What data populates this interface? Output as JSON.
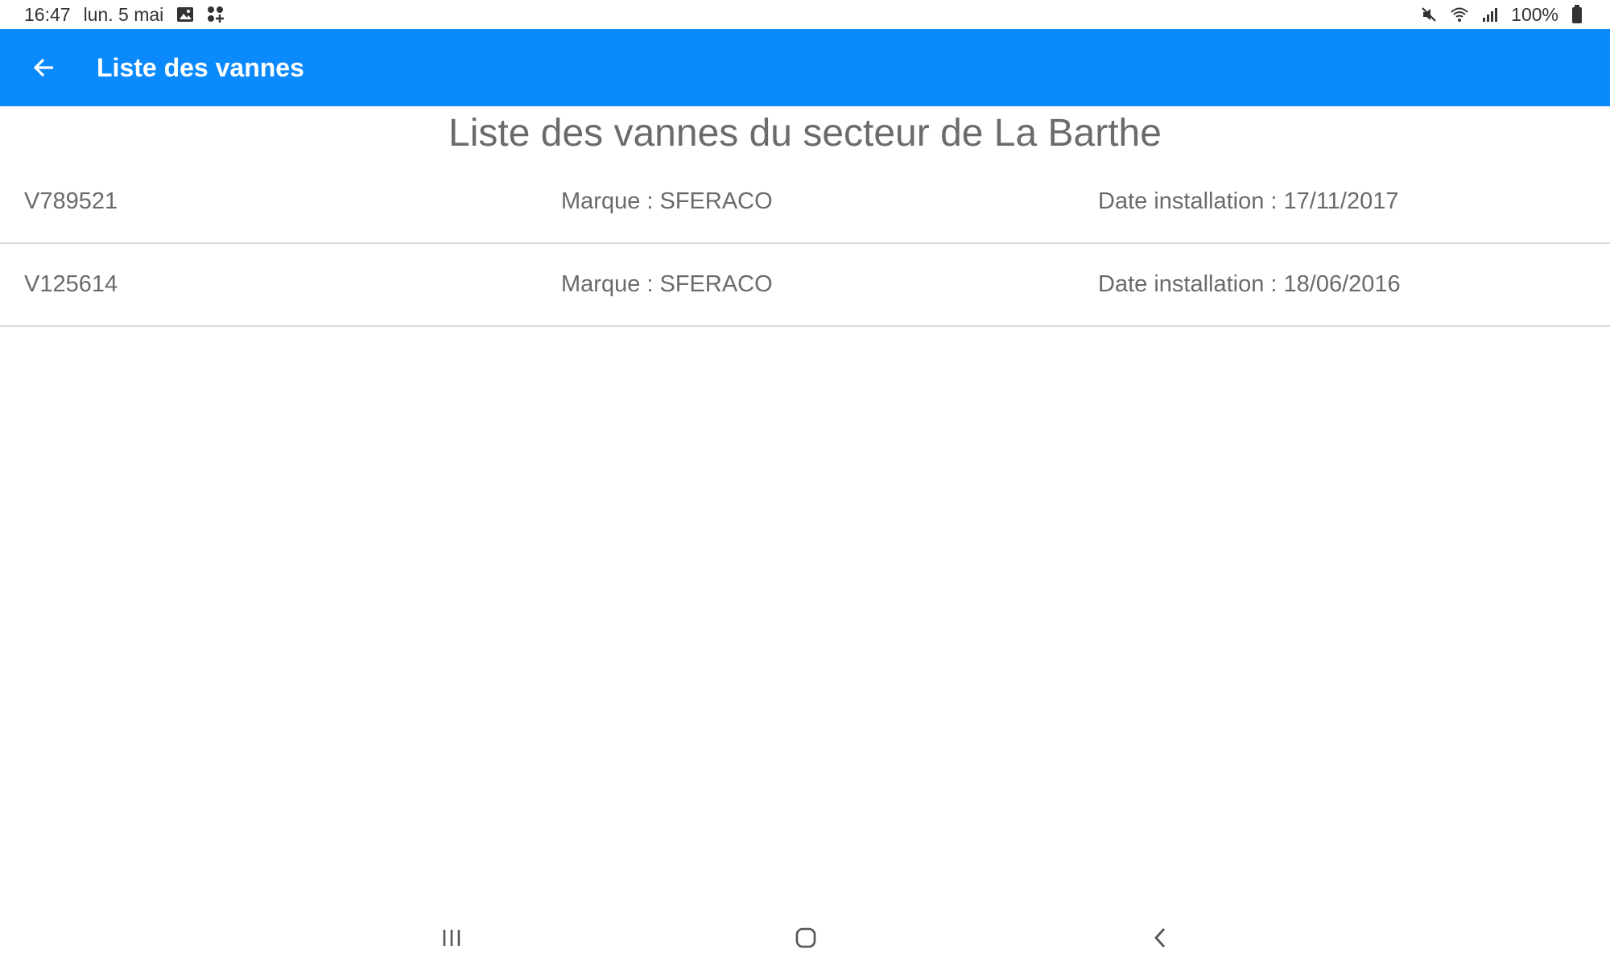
{
  "status_bar": {
    "time": "16:47",
    "date": "lun. 5 mai",
    "battery": "100%",
    "left_icons": [
      "gallery-icon",
      "apps-icon"
    ],
    "right_icons": [
      "mute-icon",
      "wifi-icon",
      "signal-icon",
      "battery-icon"
    ]
  },
  "app_bar": {
    "title": "Liste des vannes",
    "back_icon": "arrow-left-icon",
    "color": "#0a8afd"
  },
  "page": {
    "heading": "Liste des vannes du secteur de La Barthe"
  },
  "valves": [
    {
      "id": "V789521",
      "brand": "Marque : SFERACO",
      "date": "Date installation : 17/11/2017"
    },
    {
      "id": "V125614",
      "brand": "Marque : SFERACO",
      "date": "Date installation : 18/06/2016"
    }
  ],
  "nav_bar": {
    "icons": [
      "recent-apps-icon",
      "home-icon",
      "back-icon"
    ]
  }
}
